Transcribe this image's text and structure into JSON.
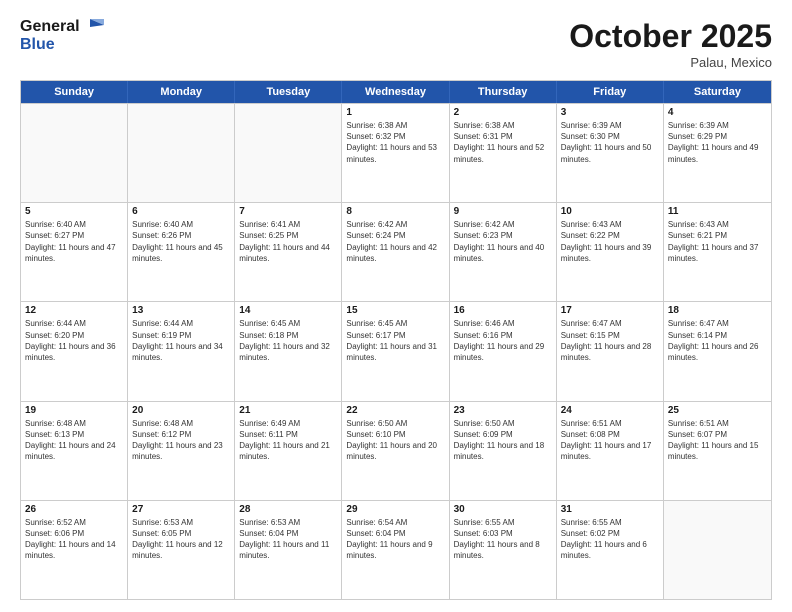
{
  "header": {
    "logo_general": "General",
    "logo_blue": "Blue",
    "month": "October 2025",
    "location": "Palau, Mexico"
  },
  "days_of_week": [
    "Sunday",
    "Monday",
    "Tuesday",
    "Wednesday",
    "Thursday",
    "Friday",
    "Saturday"
  ],
  "weeks": [
    [
      {
        "day": "",
        "empty": true
      },
      {
        "day": "",
        "empty": true
      },
      {
        "day": "",
        "empty": true
      },
      {
        "day": "1",
        "sunrise": "Sunrise: 6:38 AM",
        "sunset": "Sunset: 6:32 PM",
        "daylight": "Daylight: 11 hours and 53 minutes."
      },
      {
        "day": "2",
        "sunrise": "Sunrise: 6:38 AM",
        "sunset": "Sunset: 6:31 PM",
        "daylight": "Daylight: 11 hours and 52 minutes."
      },
      {
        "day": "3",
        "sunrise": "Sunrise: 6:39 AM",
        "sunset": "Sunset: 6:30 PM",
        "daylight": "Daylight: 11 hours and 50 minutes."
      },
      {
        "day": "4",
        "sunrise": "Sunrise: 6:39 AM",
        "sunset": "Sunset: 6:29 PM",
        "daylight": "Daylight: 11 hours and 49 minutes."
      }
    ],
    [
      {
        "day": "5",
        "sunrise": "Sunrise: 6:40 AM",
        "sunset": "Sunset: 6:27 PM",
        "daylight": "Daylight: 11 hours and 47 minutes."
      },
      {
        "day": "6",
        "sunrise": "Sunrise: 6:40 AM",
        "sunset": "Sunset: 6:26 PM",
        "daylight": "Daylight: 11 hours and 45 minutes."
      },
      {
        "day": "7",
        "sunrise": "Sunrise: 6:41 AM",
        "sunset": "Sunset: 6:25 PM",
        "daylight": "Daylight: 11 hours and 44 minutes."
      },
      {
        "day": "8",
        "sunrise": "Sunrise: 6:42 AM",
        "sunset": "Sunset: 6:24 PM",
        "daylight": "Daylight: 11 hours and 42 minutes."
      },
      {
        "day": "9",
        "sunrise": "Sunrise: 6:42 AM",
        "sunset": "Sunset: 6:23 PM",
        "daylight": "Daylight: 11 hours and 40 minutes."
      },
      {
        "day": "10",
        "sunrise": "Sunrise: 6:43 AM",
        "sunset": "Sunset: 6:22 PM",
        "daylight": "Daylight: 11 hours and 39 minutes."
      },
      {
        "day": "11",
        "sunrise": "Sunrise: 6:43 AM",
        "sunset": "Sunset: 6:21 PM",
        "daylight": "Daylight: 11 hours and 37 minutes."
      }
    ],
    [
      {
        "day": "12",
        "sunrise": "Sunrise: 6:44 AM",
        "sunset": "Sunset: 6:20 PM",
        "daylight": "Daylight: 11 hours and 36 minutes."
      },
      {
        "day": "13",
        "sunrise": "Sunrise: 6:44 AM",
        "sunset": "Sunset: 6:19 PM",
        "daylight": "Daylight: 11 hours and 34 minutes."
      },
      {
        "day": "14",
        "sunrise": "Sunrise: 6:45 AM",
        "sunset": "Sunset: 6:18 PM",
        "daylight": "Daylight: 11 hours and 32 minutes."
      },
      {
        "day": "15",
        "sunrise": "Sunrise: 6:45 AM",
        "sunset": "Sunset: 6:17 PM",
        "daylight": "Daylight: 11 hours and 31 minutes."
      },
      {
        "day": "16",
        "sunrise": "Sunrise: 6:46 AM",
        "sunset": "Sunset: 6:16 PM",
        "daylight": "Daylight: 11 hours and 29 minutes."
      },
      {
        "day": "17",
        "sunrise": "Sunrise: 6:47 AM",
        "sunset": "Sunset: 6:15 PM",
        "daylight": "Daylight: 11 hours and 28 minutes."
      },
      {
        "day": "18",
        "sunrise": "Sunrise: 6:47 AM",
        "sunset": "Sunset: 6:14 PM",
        "daylight": "Daylight: 11 hours and 26 minutes."
      }
    ],
    [
      {
        "day": "19",
        "sunrise": "Sunrise: 6:48 AM",
        "sunset": "Sunset: 6:13 PM",
        "daylight": "Daylight: 11 hours and 24 minutes."
      },
      {
        "day": "20",
        "sunrise": "Sunrise: 6:48 AM",
        "sunset": "Sunset: 6:12 PM",
        "daylight": "Daylight: 11 hours and 23 minutes."
      },
      {
        "day": "21",
        "sunrise": "Sunrise: 6:49 AM",
        "sunset": "Sunset: 6:11 PM",
        "daylight": "Daylight: 11 hours and 21 minutes."
      },
      {
        "day": "22",
        "sunrise": "Sunrise: 6:50 AM",
        "sunset": "Sunset: 6:10 PM",
        "daylight": "Daylight: 11 hours and 20 minutes."
      },
      {
        "day": "23",
        "sunrise": "Sunrise: 6:50 AM",
        "sunset": "Sunset: 6:09 PM",
        "daylight": "Daylight: 11 hours and 18 minutes."
      },
      {
        "day": "24",
        "sunrise": "Sunrise: 6:51 AM",
        "sunset": "Sunset: 6:08 PM",
        "daylight": "Daylight: 11 hours and 17 minutes."
      },
      {
        "day": "25",
        "sunrise": "Sunrise: 6:51 AM",
        "sunset": "Sunset: 6:07 PM",
        "daylight": "Daylight: 11 hours and 15 minutes."
      }
    ],
    [
      {
        "day": "26",
        "sunrise": "Sunrise: 6:52 AM",
        "sunset": "Sunset: 6:06 PM",
        "daylight": "Daylight: 11 hours and 14 minutes."
      },
      {
        "day": "27",
        "sunrise": "Sunrise: 6:53 AM",
        "sunset": "Sunset: 6:05 PM",
        "daylight": "Daylight: 11 hours and 12 minutes."
      },
      {
        "day": "28",
        "sunrise": "Sunrise: 6:53 AM",
        "sunset": "Sunset: 6:04 PM",
        "daylight": "Daylight: 11 hours and 11 minutes."
      },
      {
        "day": "29",
        "sunrise": "Sunrise: 6:54 AM",
        "sunset": "Sunset: 6:04 PM",
        "daylight": "Daylight: 11 hours and 9 minutes."
      },
      {
        "day": "30",
        "sunrise": "Sunrise: 6:55 AM",
        "sunset": "Sunset: 6:03 PM",
        "daylight": "Daylight: 11 hours and 8 minutes."
      },
      {
        "day": "31",
        "sunrise": "Sunrise: 6:55 AM",
        "sunset": "Sunset: 6:02 PM",
        "daylight": "Daylight: 11 hours and 6 minutes."
      },
      {
        "day": "",
        "empty": true
      }
    ]
  ]
}
